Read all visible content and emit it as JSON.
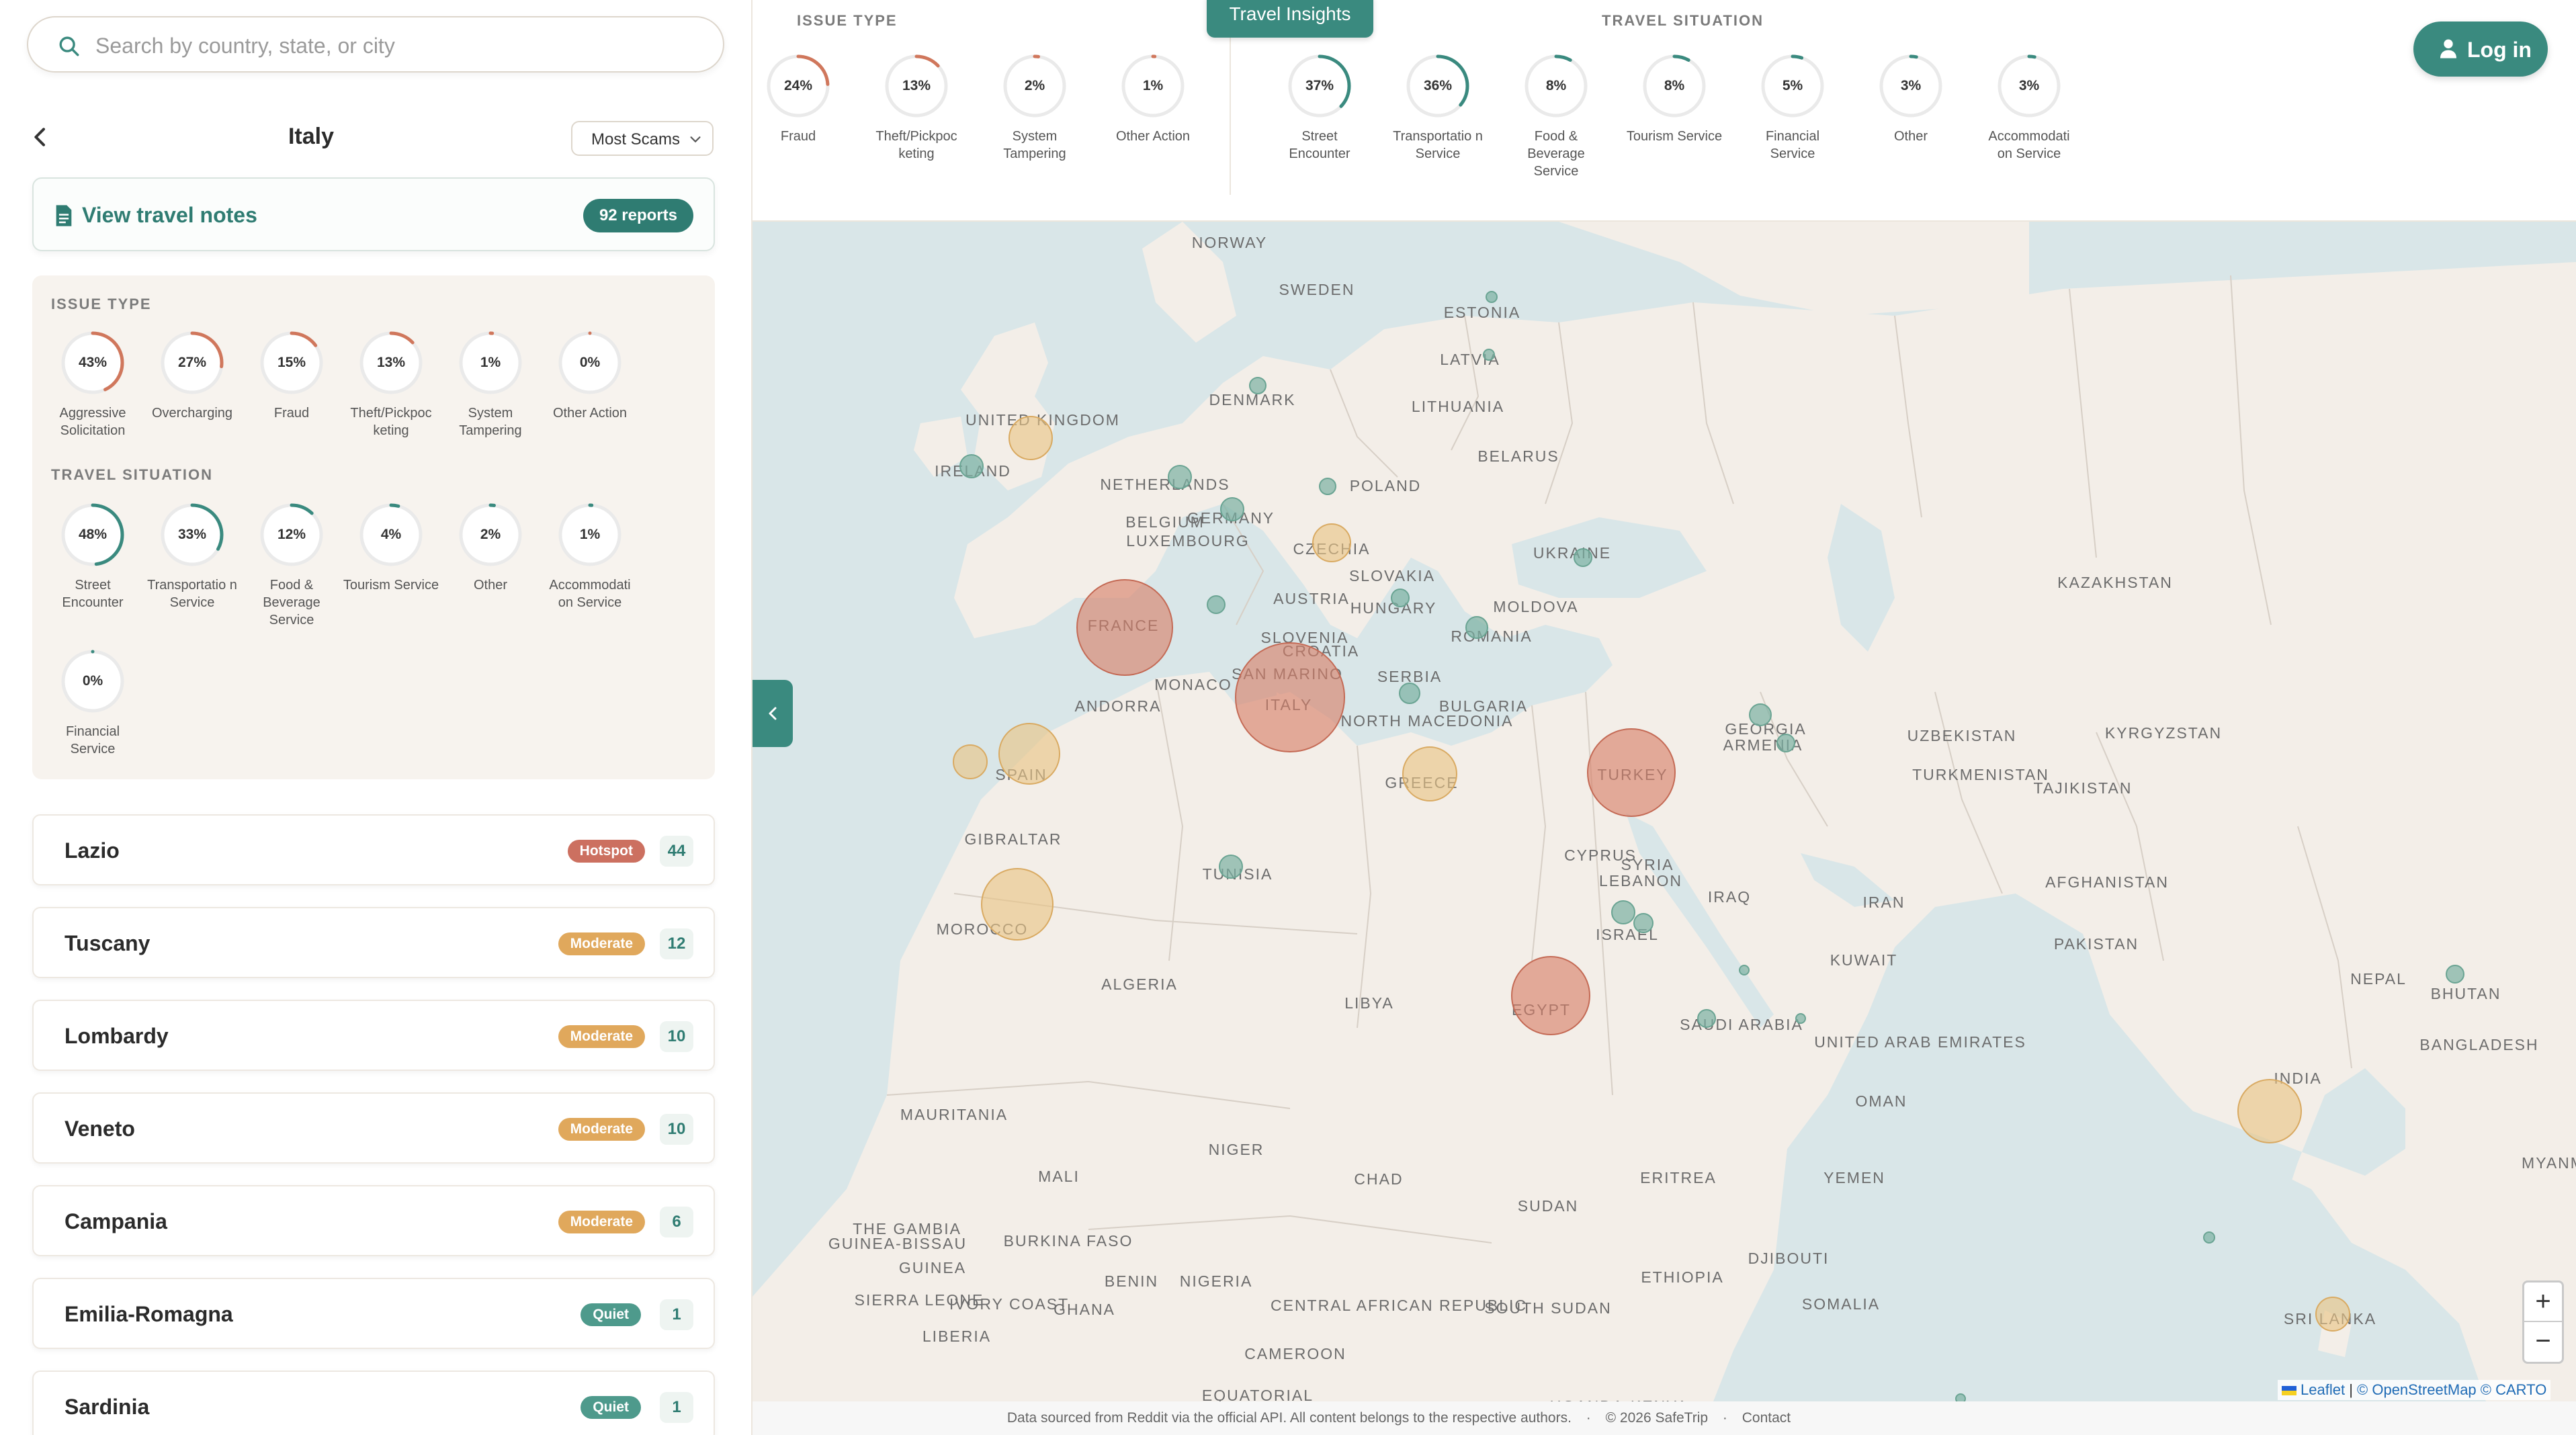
{
  "search": {
    "placeholder": "Search by country, state, or city"
  },
  "sidebar": {
    "country": "Italy",
    "sort": "Most Scams",
    "notes_label": "View travel notes",
    "reports": "92 reports",
    "issue_type_title": "ISSUE TYPE",
    "travel_situation_title": "TRAVEL SITUATION",
    "issue_types": [
      {
        "pct": "43%",
        "value": 43,
        "label": "Aggressive Solicitation"
      },
      {
        "pct": "27%",
        "value": 27,
        "label": "Overcharging"
      },
      {
        "pct": "15%",
        "value": 15,
        "label": "Fraud"
      },
      {
        "pct": "13%",
        "value": 13,
        "label": "Theft/Pickpoc keting"
      },
      {
        "pct": "1%",
        "value": 1,
        "label": "System Tampering"
      },
      {
        "pct": "0%",
        "value": 0,
        "label": "Other Action"
      }
    ],
    "travel_situations": [
      {
        "pct": "48%",
        "value": 48,
        "label": "Street Encounter"
      },
      {
        "pct": "33%",
        "value": 33,
        "label": "Transportatio n Service"
      },
      {
        "pct": "12%",
        "value": 12,
        "label": "Food & Beverage Service"
      },
      {
        "pct": "4%",
        "value": 4,
        "label": "Tourism Service"
      },
      {
        "pct": "2%",
        "value": 2,
        "label": "Other"
      },
      {
        "pct": "1%",
        "value": 1,
        "label": "Accommodati on Service"
      },
      {
        "pct": "0%",
        "value": 0,
        "label": "Financial Service"
      }
    ],
    "regions": [
      {
        "name": "Lazio",
        "status": "Hotspot",
        "count": "44"
      },
      {
        "name": "Tuscany",
        "status": "Moderate",
        "count": "12"
      },
      {
        "name": "Lombardy",
        "status": "Moderate",
        "count": "10"
      },
      {
        "name": "Veneto",
        "status": "Moderate",
        "count": "10"
      },
      {
        "name": "Campania",
        "status": "Moderate",
        "count": "6"
      },
      {
        "name": "Emilia-Romagna",
        "status": "Quiet",
        "count": "1"
      },
      {
        "name": "Sardinia",
        "status": "Quiet",
        "count": "1"
      }
    ]
  },
  "insights": {
    "tab_label": "Travel Insights",
    "issue_type_title": "ISSUE TYPE",
    "travel_situation_title": "TRAVEL SITUATION",
    "issue_types": [
      {
        "pct": "24%",
        "value": 24,
        "label": "Fraud"
      },
      {
        "pct": "13%",
        "value": 13,
        "label": "Theft/Pickpoc keting"
      },
      {
        "pct": "2%",
        "value": 2,
        "label": "System Tampering"
      },
      {
        "pct": "1%",
        "value": 1,
        "label": "Other Action"
      }
    ],
    "travel_situations": [
      {
        "pct": "37%",
        "value": 37,
        "label": "Street Encounter"
      },
      {
        "pct": "36%",
        "value": 36,
        "label": "Transportatio n Service"
      },
      {
        "pct": "8%",
        "value": 8,
        "label": "Food & Beverage Service"
      },
      {
        "pct": "8%",
        "value": 8,
        "label": "Tourism Service"
      },
      {
        "pct": "5%",
        "value": 5,
        "label": "Financial Service"
      },
      {
        "pct": "3%",
        "value": 3,
        "label": "Other"
      },
      {
        "pct": "3%",
        "value": 3,
        "label": "Accommodati on Service"
      }
    ]
  },
  "header": {
    "login_label": "Log in"
  },
  "map": {
    "labels": [
      "NORWAY",
      "SWEDEN",
      "ESTONIA",
      "LATVIA",
      "DENMARK",
      "LITHUANIA",
      "UNITED KINGDOM",
      "IRELAND",
      "BELARUS",
      "NETHERLANDS",
      "POLAND",
      "BELGIUM",
      "GERMANY",
      "LUXEMBOURG",
      "CZECHIA",
      "UKRAINE",
      "SLOVAKIA",
      "KAZAKHSTAN",
      "FRANCE",
      "AUSTRIA",
      "HUNGARY",
      "MOLDOVA",
      "SLOVENIA",
      "CROATIA",
      "ROMANIA",
      "SAN MARINO",
      "MONACO",
      "ITALY",
      "SERBIA",
      "ANDORRA",
      "BULGARIA",
      "NORTH MACEDONIA",
      "GEORGIA",
      "ARMENIA",
      "UZBEKISTAN",
      "KYRGYZSTAN",
      "SPAIN",
      "GREECE",
      "TURKEY",
      "TURKMENISTAN",
      "TAJIKISTAN",
      "GIBRALTAR",
      "TUNISIA",
      "CYPRUS",
      "SYRIA",
      "LEBANON",
      "IRAQ",
      "AFGHANISTAN",
      "IRAN",
      "ISRAEL",
      "MOROCCO",
      "PAKISTAN",
      "KUWAIT",
      "ALGERIA",
      "LIBYA",
      "EGYPT",
      "SAUDI ARABIA",
      "NEPAL",
      "BHUTAN",
      "UNITED ARAB EMIRATES",
      "BANGLADESH",
      "INDIA",
      "OMAN",
      "MAURITANIA",
      "NIGER",
      "MALI",
      "CHAD",
      "ERITREA",
      "YEMEN",
      "SUDAN",
      "MYANM",
      "THE GAMBIA",
      "GUINEA-BISSAU",
      "GUINEA",
      "BURKINA FASO",
      "DJIBOUTI",
      "BENIN",
      "NIGERIA",
      "ETHIOPIA",
      "SIERRA LEONE",
      "IVORY COAST",
      "GHANA",
      "SOMALIA",
      "CENTRAL AFRICAN REPUBLIC",
      "SOUTH SUDAN",
      "SRI LANKA",
      "LIBERIA",
      "CAMEROON",
      "EQUATORIAL",
      "UGANDA",
      "KENYA"
    ]
  },
  "attribution": {
    "leaflet": "Leaflet",
    "sep": "|",
    "osm": "© OpenStreetMap",
    "carto": "© CARTO"
  },
  "footer": {
    "source": "Data sourced from Reddit via the official API. All content belongs to the respective authors.",
    "dot": "·",
    "copyright": "© 2026 SafeTrip",
    "contact": "Contact"
  },
  "colors": {
    "accent": "#3a8a7f",
    "issue_ring": "#d0775c",
    "situation_ring": "#3a8a7f",
    "hotspot": "#cc7060",
    "moderate": "#e0a85c",
    "quiet": "#4e9a8c"
  }
}
